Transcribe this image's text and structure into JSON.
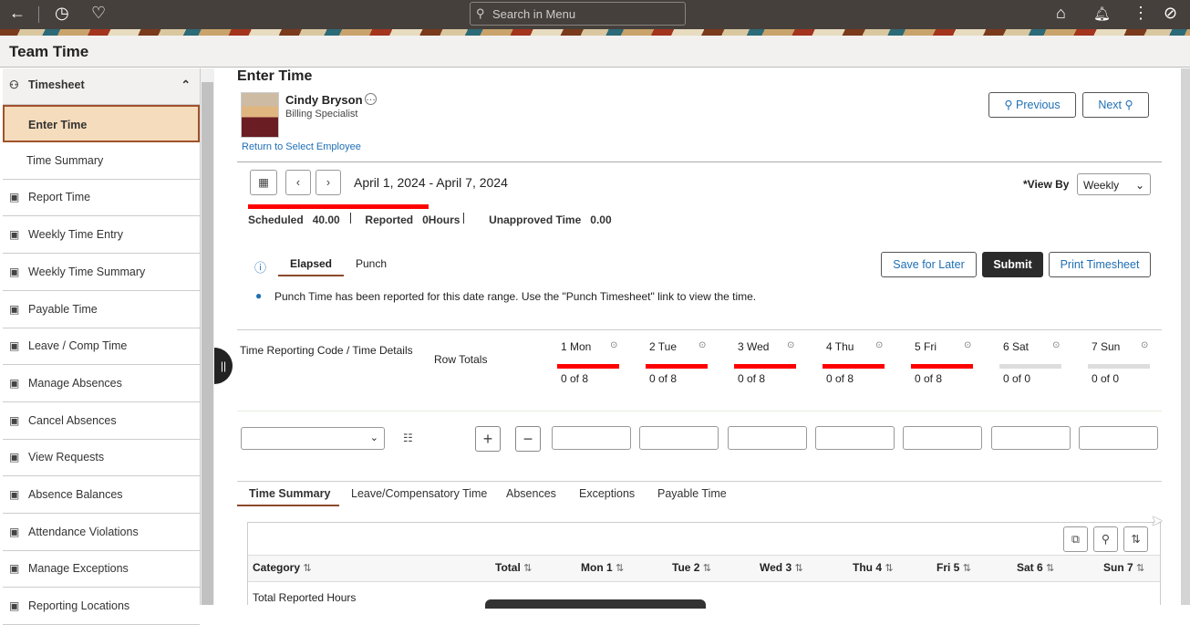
{
  "topbar": {
    "search_placeholder": "Search in Menu"
  },
  "header": {
    "title": "Team Time"
  },
  "sidebar": {
    "section": "Timesheet",
    "items": [
      {
        "label": "Enter Time",
        "icon": "none"
      },
      {
        "label": "Time Summary",
        "icon": "none"
      },
      {
        "label": "Report Time",
        "icon": "report-icon"
      },
      {
        "label": "Weekly Time Entry",
        "icon": "clock-icon"
      },
      {
        "label": "Weekly Time Summary",
        "icon": "calendar-icon"
      },
      {
        "label": "Payable Time",
        "icon": "payable-icon"
      },
      {
        "label": "Leave / Comp Time",
        "icon": "scale-icon"
      },
      {
        "label": "Manage Absences",
        "icon": "building-icon"
      },
      {
        "label": "Cancel Absences",
        "icon": "cancel-calendar-icon"
      },
      {
        "label": "View Requests",
        "icon": "document-icon"
      },
      {
        "label": "Absence Balances",
        "icon": "scale-icon"
      },
      {
        "label": "Attendance Violations",
        "icon": "calendar-icon"
      },
      {
        "label": "Manage Exceptions",
        "icon": "warning-icon"
      },
      {
        "label": "Reporting Locations",
        "icon": "location-icon"
      }
    ]
  },
  "main": {
    "title": "Enter Time",
    "employee": {
      "name": "Cindy Bryson",
      "role": "Billing Specialist"
    },
    "return_link": "Return to Select Employee",
    "previous": "Previous",
    "next": "Next",
    "date_range": "April 1, 2024 - April 7, 2024",
    "view_by_label": "*View By",
    "view_by_value": "Weekly",
    "scheduled_label": "Scheduled",
    "scheduled_value": "40.00",
    "reported_label": "Reported",
    "reported_value": "0Hours",
    "unapproved_label": "Unapproved Time",
    "unapproved_value": "0.00",
    "tabs": [
      "Elapsed",
      "Punch"
    ],
    "save_later": "Save for Later",
    "submit": "Submit",
    "print": "Print Timesheet",
    "info_msg": "Punch Time has been reported for this date range. Use the \"Punch Timesheet\" link to view the time.",
    "trc_header": "Time Reporting Code / Time Details",
    "row_totals": "Row Totals",
    "days": [
      {
        "label": "1 Mon",
        "of": "0 of 8"
      },
      {
        "label": "2 Tue",
        "of": "0 of 8"
      },
      {
        "label": "3 Wed",
        "of": "0 of 8"
      },
      {
        "label": "4 Thu",
        "of": "0 of 8"
      },
      {
        "label": "5 Fri",
        "of": "0 of 8"
      },
      {
        "label": "6 Sat",
        "of": "0 of 0"
      },
      {
        "label": "7 Sun",
        "of": "0 of 0"
      }
    ],
    "bottom_tabs": [
      "Time Summary",
      "Leave/Compensatory Time",
      "Absences",
      "Exceptions",
      "Payable Time"
    ],
    "summary_headers": [
      "Category",
      "Total",
      "Mon 1",
      "Tue 2",
      "Wed 3",
      "Thu 4",
      "Fri 5",
      "Sat 6",
      "Sun 7"
    ],
    "summary_rows": [
      "Total Reported Hours"
    ]
  },
  "colors": {
    "accent": "#1f6fb5",
    "alert": "#ff0000",
    "selected": "#f5dcbc"
  }
}
